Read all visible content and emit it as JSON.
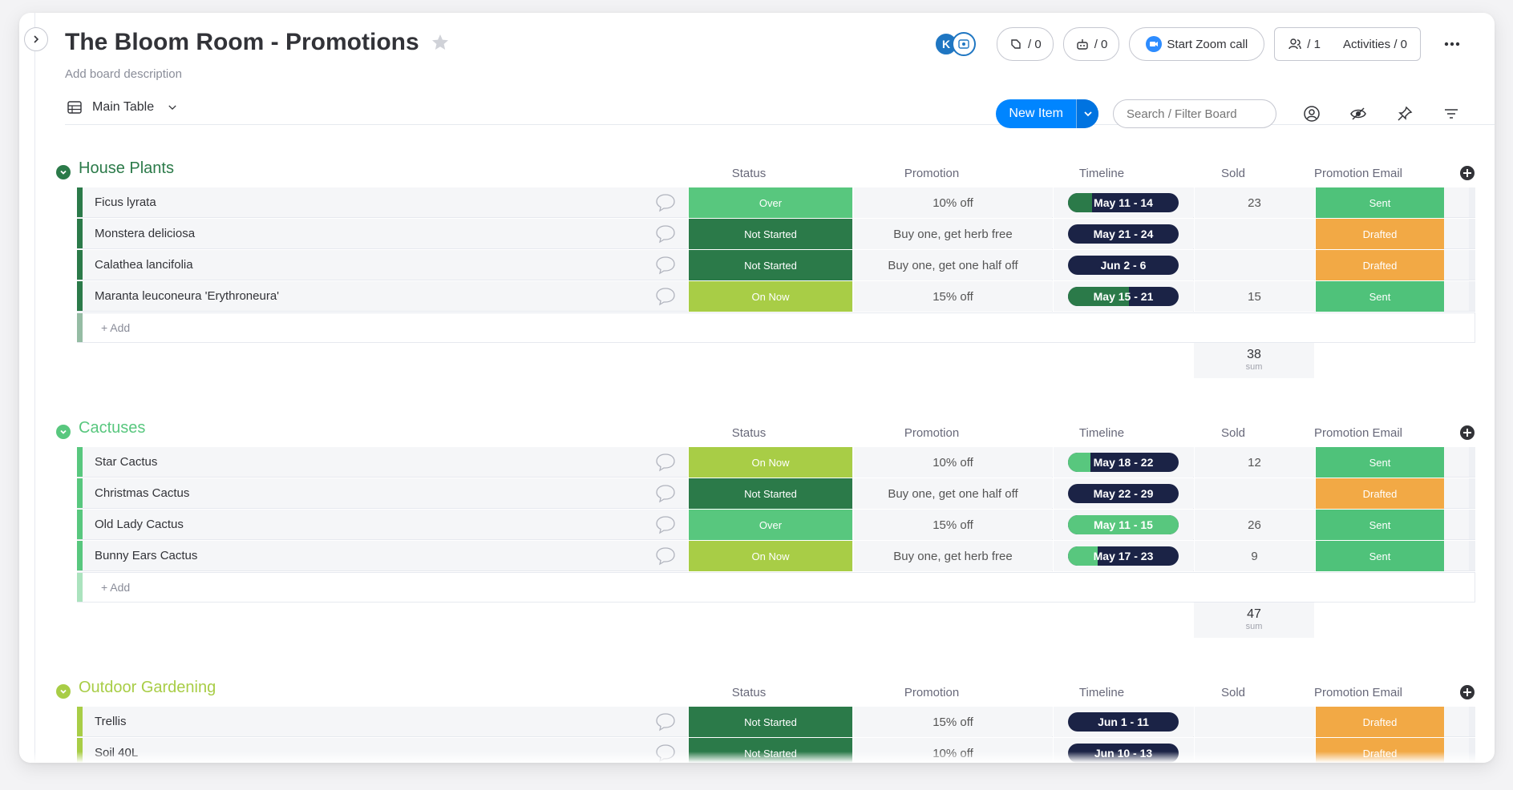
{
  "board": {
    "title": "The Bloom Room - Promotions",
    "description": "Add board description"
  },
  "header": {
    "avatar_initial": "K",
    "integrations_count": "/ 0",
    "automations_count": "/ 0",
    "zoom_label": "Start Zoom call",
    "members_count": "/ 1",
    "activities_label": "Activities / 0"
  },
  "toolbar": {
    "view_label": "Main Table",
    "new_item_label": "New Item",
    "search_placeholder": "Search / Filter Board"
  },
  "columns": {
    "status": "Status",
    "promotion": "Promotion",
    "timeline": "Timeline",
    "sold": "Sold",
    "email": "Promotion Email"
  },
  "colors": {
    "over": "#58c77e",
    "not_started": "#2b7a49",
    "on_now": "#a8cd46",
    "sent": "#4fc27a",
    "drafted": "#f2a945",
    "timeline_dark": "#1b2346"
  },
  "add_label": "+ Add",
  "sum_label": "sum",
  "groups": [
    {
      "title": "House Plants",
      "color": "#2b7a49",
      "sum": "38",
      "items": [
        {
          "name": "Ficus lyrata",
          "status": "Over",
          "status_key": "over",
          "promotion": "10% off",
          "timeline": "May 11 - 14",
          "progress": 0.22,
          "fill": "#2b7a49",
          "sold": "23",
          "email": "Sent",
          "email_key": "sent"
        },
        {
          "name": "Monstera deliciosa",
          "status": "Not Started",
          "status_key": "not_started",
          "promotion": "Buy one, get herb free",
          "timeline": "May 21 - 24",
          "progress": 0,
          "fill": "#2b7a49",
          "sold": "",
          "email": "Drafted",
          "email_key": "drafted"
        },
        {
          "name": "Calathea lancifolia",
          "status": "Not Started",
          "status_key": "not_started",
          "promotion": "Buy one, get one half off",
          "timeline": "Jun 2 - 6",
          "progress": 0,
          "fill": "#2b7a49",
          "sold": "",
          "email": "Drafted",
          "email_key": "drafted"
        },
        {
          "name": "Maranta leuconeura 'Erythroneura'",
          "status": "On Now",
          "status_key": "on_now",
          "promotion": "15% off",
          "timeline": "May 15 - 21",
          "progress": 0.55,
          "fill": "#2b7a49",
          "sold": "15",
          "email": "Sent",
          "email_key": "sent"
        }
      ]
    },
    {
      "title": "Cactuses",
      "color": "#58c77e",
      "sum": "47",
      "items": [
        {
          "name": "Star Cactus",
          "status": "On Now",
          "status_key": "on_now",
          "promotion": "10% off",
          "timeline": "May 18 - 22",
          "progress": 0.2,
          "fill": "#58c77e",
          "sold": "12",
          "email": "Sent",
          "email_key": "sent"
        },
        {
          "name": "Christmas Cactus",
          "status": "Not Started",
          "status_key": "not_started",
          "promotion": "Buy one, get one half off",
          "timeline": "May 22 - 29",
          "progress": 0,
          "fill": "#58c77e",
          "sold": "",
          "email": "Drafted",
          "email_key": "drafted"
        },
        {
          "name": "Old Lady Cactus",
          "status": "Over",
          "status_key": "over",
          "promotion": "15% off",
          "timeline": "May 11 - 15",
          "progress": 1,
          "fill": "#58c77e",
          "sold": "26",
          "email": "Sent",
          "email_key": "sent"
        },
        {
          "name": "Bunny Ears Cactus",
          "status": "On Now",
          "status_key": "on_now",
          "promotion": "Buy one, get herb free",
          "timeline": "May 17 - 23",
          "progress": 0.27,
          "fill": "#58c77e",
          "sold": "9",
          "email": "Sent",
          "email_key": "sent"
        }
      ]
    },
    {
      "title": "Outdoor Gardening",
      "color": "#a8cd46",
      "sum": "",
      "items": [
        {
          "name": "Trellis",
          "status": "Not Started",
          "status_key": "not_started",
          "promotion": "15% off",
          "timeline": "Jun 1 - 11",
          "progress": 0,
          "fill": "#a8cd46",
          "sold": "",
          "email": "Drafted",
          "email_key": "drafted"
        },
        {
          "name": "Soil 40L",
          "status": "Not Started",
          "status_key": "not_started",
          "promotion": "10% off",
          "timeline": "Jun 10 - 13",
          "progress": 0,
          "fill": "#a8cd46",
          "sold": "",
          "email": "Drafted",
          "email_key": "drafted"
        }
      ]
    }
  ]
}
